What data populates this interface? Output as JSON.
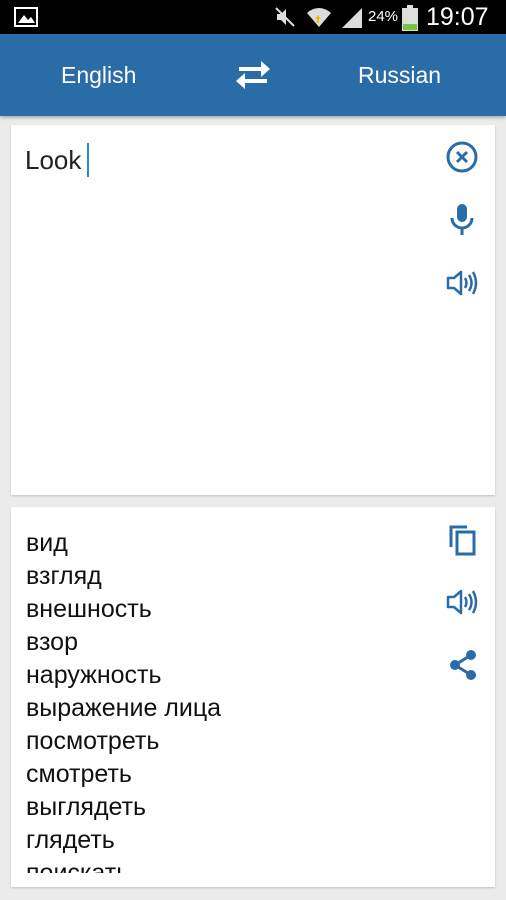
{
  "status_bar": {
    "battery_percent": "24%",
    "time": "19:07",
    "icons": [
      "gallery-icon",
      "mute-icon",
      "wifi-icon",
      "signal-icon",
      "battery-icon"
    ]
  },
  "app_bar": {
    "source_language": "English",
    "target_language": "Russian",
    "swap_icon": "swap-arrows-icon",
    "background_color": "#2a6ca8"
  },
  "input": {
    "text": "Look",
    "icons": [
      "clear-icon",
      "microphone-icon",
      "speaker-icon"
    ]
  },
  "output": {
    "translations": [
      "вид",
      "взгляд",
      "внешность",
      "взор",
      "наружность",
      "выражение лица",
      "посмотреть",
      "смотреть",
      "выглядеть",
      "глядеть",
      "поискать"
    ],
    "icons": [
      "copy-icon",
      "speaker-icon",
      "share-icon"
    ]
  },
  "colors": {
    "accent": "#2a6ca8",
    "icon": "#2a6ca8",
    "cursor": "#2a86d8"
  }
}
